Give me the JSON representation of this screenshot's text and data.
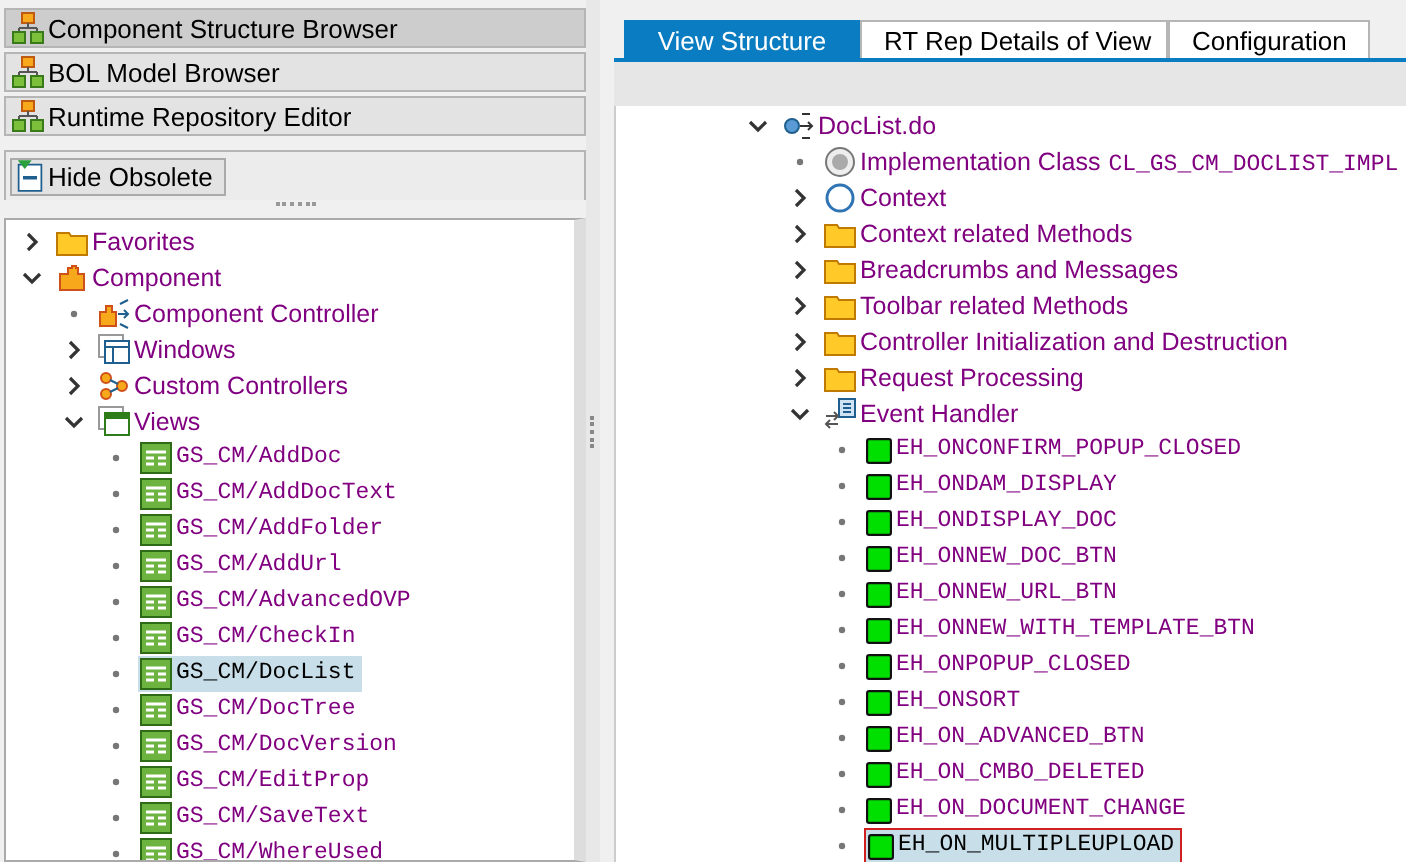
{
  "browsers": [
    {
      "label": "Component Structure Browser",
      "selected": true
    },
    {
      "label": "BOL Model Browser",
      "selected": false
    },
    {
      "label": "Runtime Repository Editor",
      "selected": false
    }
  ],
  "toolbar": {
    "button": "Hide Obsolete"
  },
  "component_tree": [
    {
      "label": "Favorites",
      "kind": "folder",
      "expanded": false,
      "selected": false
    },
    {
      "label": "Component",
      "kind": "component",
      "expanded": true,
      "selected": false,
      "children": [
        {
          "label": "Component Controller",
          "kind": "controller",
          "selected": false
        },
        {
          "label": "Windows",
          "kind": "windows",
          "expanded": false,
          "selected": false
        },
        {
          "label": "Custom Controllers",
          "kind": "custom-controllers",
          "expanded": false,
          "selected": false
        },
        {
          "label": "Views",
          "kind": "views",
          "expanded": true,
          "selected": false,
          "children": [
            {
              "label": "GS_CM/AddDoc",
              "kind": "view",
              "selected": false
            },
            {
              "label": "GS_CM/AddDocText",
              "kind": "view",
              "selected": false
            },
            {
              "label": "GS_CM/AddFolder",
              "kind": "view",
              "selected": false
            },
            {
              "label": "GS_CM/AddUrl",
              "kind": "view",
              "selected": false
            },
            {
              "label": "GS_CM/AdvancedOVP",
              "kind": "view",
              "selected": false
            },
            {
              "label": "GS_CM/CheckIn",
              "kind": "view",
              "selected": false
            },
            {
              "label": "GS_CM/DocList",
              "kind": "view",
              "selected": true
            },
            {
              "label": "GS_CM/DocTree",
              "kind": "view",
              "selected": false
            },
            {
              "label": "GS_CM/DocVersion",
              "kind": "view",
              "selected": false
            },
            {
              "label": "GS_CM/EditProp",
              "kind": "view",
              "selected": false
            },
            {
              "label": "GS_CM/SaveText",
              "kind": "view",
              "selected": false
            },
            {
              "label": "GS_CM/WhereUsed",
              "kind": "view",
              "selected": false
            }
          ]
        }
      ]
    }
  ],
  "tabs": [
    {
      "label": "View Structure",
      "selected": true
    },
    {
      "label": "RT Rep Details of View",
      "selected": false
    },
    {
      "label": "Configuration",
      "selected": false
    }
  ],
  "view_tree": [
    {
      "label": "DocList.do",
      "kind": "view-controller",
      "expanded": true,
      "selected": false,
      "children": [
        {
          "label": "Implementation Class",
          "value": "CL_GS_CM_DOCLIST_IMPL",
          "kind": "class",
          "selected": false
        },
        {
          "label": "Context",
          "kind": "context",
          "expanded": false,
          "selected": false
        },
        {
          "label": "Context related Methods",
          "kind": "folder",
          "expanded": false,
          "selected": false
        },
        {
          "label": "Breadcrumbs and Messages",
          "kind": "folder",
          "expanded": false,
          "selected": false
        },
        {
          "label": "Toolbar related Methods",
          "kind": "folder",
          "expanded": false,
          "selected": false
        },
        {
          "label": "Controller Initialization and Destruction",
          "kind": "folder",
          "expanded": false,
          "selected": false
        },
        {
          "label": "Request Processing",
          "kind": "folder",
          "expanded": false,
          "selected": false
        },
        {
          "label": "Event Handler",
          "kind": "event-handler",
          "expanded": true,
          "selected": false,
          "children": [
            {
              "label": "EH_ONCONFIRM_POPUP_CLOSED",
              "kind": "method",
              "selected": false
            },
            {
              "label": "EH_ONDAM_DISPLAY",
              "kind": "method",
              "selected": false
            },
            {
              "label": "EH_ONDISPLAY_DOC",
              "kind": "method",
              "selected": false
            },
            {
              "label": "EH_ONNEW_DOC_BTN",
              "kind": "method",
              "selected": false
            },
            {
              "label": "EH_ONNEW_URL_BTN",
              "kind": "method",
              "selected": false
            },
            {
              "label": "EH_ONNEW_WITH_TEMPLATE_BTN",
              "kind": "method",
              "selected": false
            },
            {
              "label": "EH_ONPOPUP_CLOSED",
              "kind": "method",
              "selected": false
            },
            {
              "label": "EH_ONSORT",
              "kind": "method",
              "selected": false
            },
            {
              "label": "EH_ON_ADVANCED_BTN",
              "kind": "method",
              "selected": false
            },
            {
              "label": "EH_ON_CMBO_DELETED",
              "kind": "method",
              "selected": false
            },
            {
              "label": "EH_ON_DOCUMENT_CHANGE",
              "kind": "method",
              "selected": false
            },
            {
              "label": "EH_ON_MULTIPLEUPLOAD",
              "kind": "method",
              "selected": true
            }
          ]
        }
      ]
    }
  ]
}
